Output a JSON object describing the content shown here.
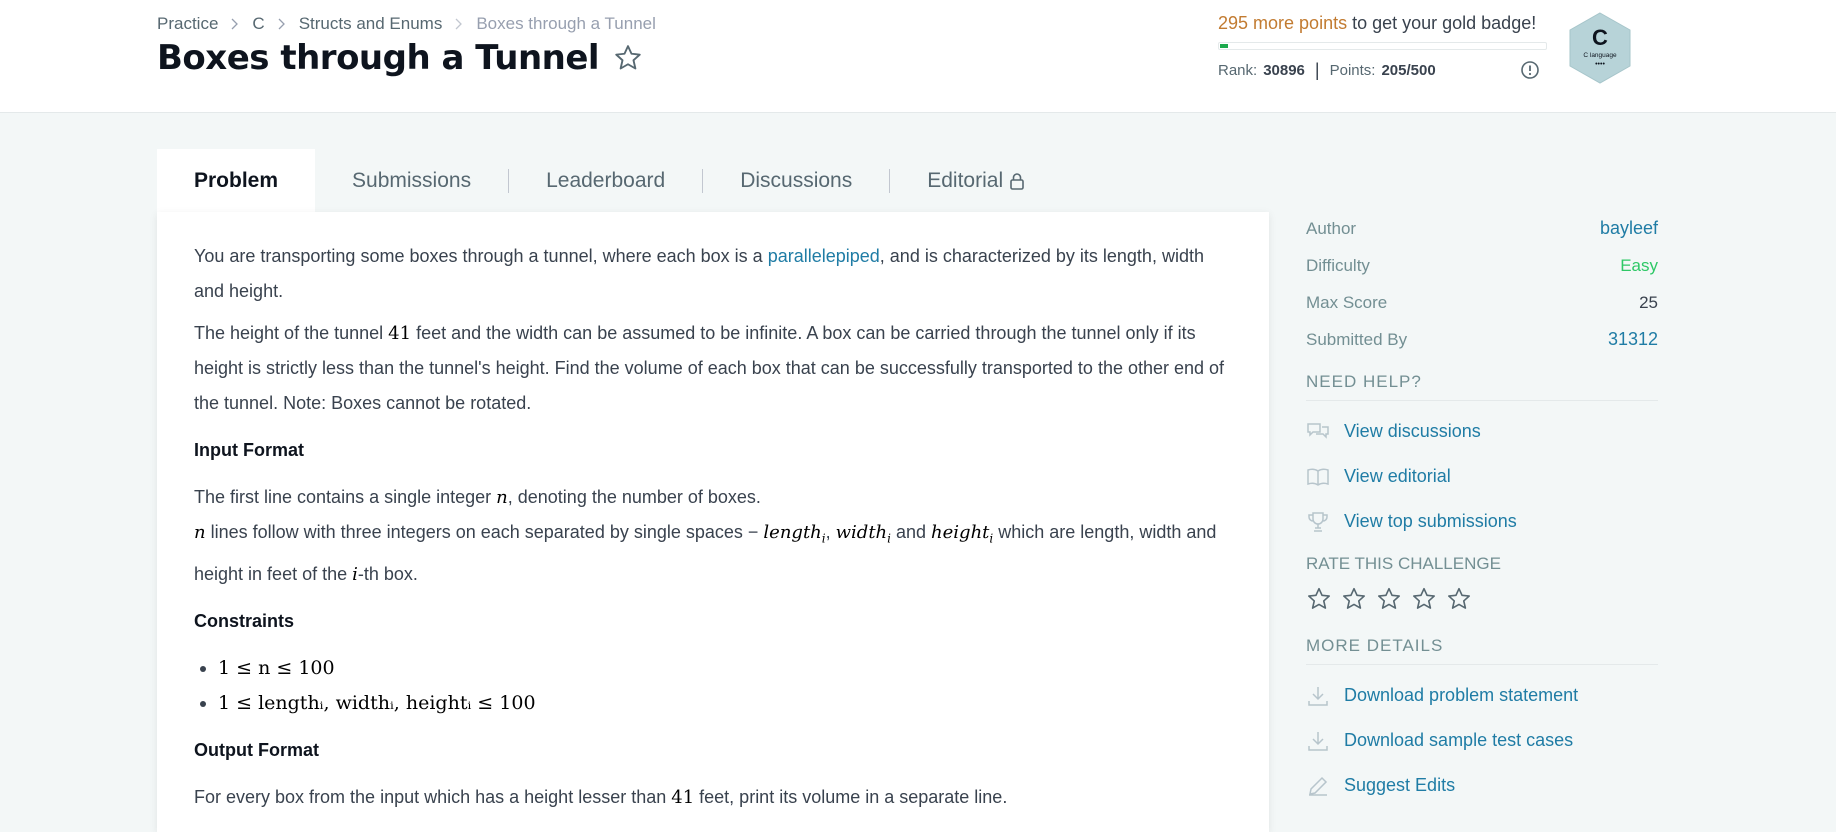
{
  "breadcrumb": {
    "items": [
      "Practice",
      "C",
      "Structs and Enums",
      "Boxes through a Tunnel"
    ]
  },
  "title": "Boxes through a Tunnel",
  "profile": {
    "points_needed": "295 more points",
    "points_suffix": " to get your gold badge!",
    "progress_fraction": 0.02,
    "rank_label": "Rank:",
    "rank_value": "30896",
    "points_label": "Points:",
    "points_value": "205/500",
    "badge_letter": "C",
    "badge_text": "C language",
    "badge_dots": "••••"
  },
  "tabs": [
    "Problem",
    "Submissions",
    "Leaderboard",
    "Discussions",
    "Editorial"
  ],
  "problem": {
    "p1_a": "You are transporting some boxes through a tunnel, where each box is a ",
    "p1_link": "parallelepiped",
    "p1_b": ", and is characterized by its length, width and height.",
    "p2_a": "The height of the tunnel ",
    "p2_num": "41",
    "p2_b": " feet and the width can be assumed to be infinite. A box can be carried through the tunnel only if its height is strictly less than the tunnel's height. Find the volume of each box that can be successfully transported to the other end of the tunnel. Note: Boxes cannot be rotated.",
    "input_heading": "Input Format",
    "in1_a": "The first line contains a single integer ",
    "in1_var": "n",
    "in1_b": ", denoting the number of boxes.",
    "in2_var": "n",
    "in2_a": " lines follow with three integers on each separated by single spaces − ",
    "in2_m1": "length",
    "in2_sep": ", ",
    "in2_m2": "width",
    "in2_and": " and ",
    "in2_m3": "height",
    "in2_sub": "i",
    "in2_b": " which are length, width and height in feet of the ",
    "in2_i": "i",
    "in2_c": "-th box.",
    "constraints_heading": "Constraints",
    "c1": "1 ≤ n ≤ 100",
    "c2": "1 ≤ lengthᵢ, widthᵢ, heightᵢ ≤ 100",
    "output_heading": "Output Format",
    "out_a": "For every box from the input which has a height lesser than ",
    "out_num": "41",
    "out_b": " feet, print its volume in a separate line."
  },
  "sidebar": {
    "meta": [
      {
        "key": "Author",
        "value": "bayleef"
      },
      {
        "key": "Difficulty",
        "value": "Easy"
      },
      {
        "key": "Max Score",
        "value": "25"
      },
      {
        "key": "Submitted By",
        "value": "31312"
      }
    ],
    "need_help": "NEED HELP?",
    "help_links": [
      "View discussions",
      "View editorial",
      "View top submissions"
    ],
    "rate": "RATE THIS CHALLENGE",
    "more": "MORE DETAILS",
    "more_links": [
      "Download problem statement",
      "Download sample test cases",
      "Suggest Edits"
    ]
  },
  "colors": {
    "link": "#1f7ca5",
    "easy": "#2ec866",
    "accent": "#c27b31",
    "progress": "#1ba94c"
  }
}
